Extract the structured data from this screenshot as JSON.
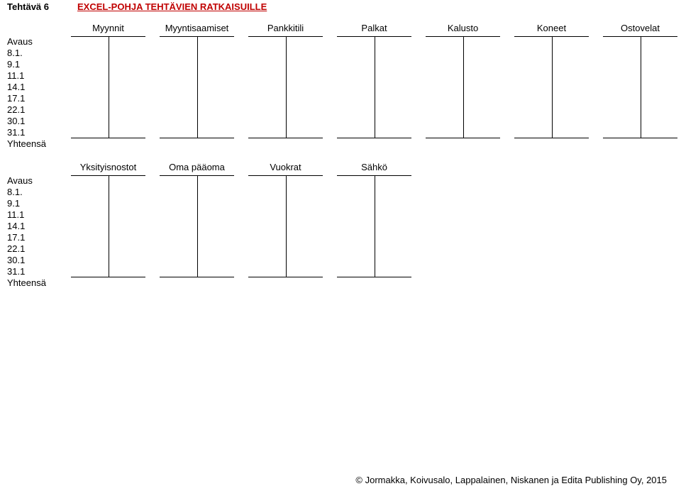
{
  "header": {
    "task": "Tehtävä 6",
    "title": "EXCEL-POHJA TEHTÄVIEN RATKAISUILLE"
  },
  "rows": {
    "r0": "Avaus",
    "r1": "8.1.",
    "r2": "9.1",
    "r3": "11.1",
    "r4": "14.1",
    "r5": "17.1",
    "r6": "22.1",
    "r7": "30.1",
    "r8": "31.1",
    "r9": "Yhteensä"
  },
  "section1": {
    "accounts": {
      "a0": "Myynnit",
      "a1": "Myyntisaamiset",
      "a2": "Pankkitili",
      "a3": "Palkat",
      "a4": "Kalusto",
      "a5": "Koneet",
      "a6": "Ostovelat"
    }
  },
  "section2": {
    "accounts": {
      "a0": "Yksityisnostot",
      "a1": "Oma pääoma",
      "a2": "Vuokrat",
      "a3": "Sähkö"
    }
  },
  "footer": {
    "copyright": "© Jormakka, Koivusalo, Lappalainen, Niskanen ja Edita Publishing Oy, 2015"
  }
}
